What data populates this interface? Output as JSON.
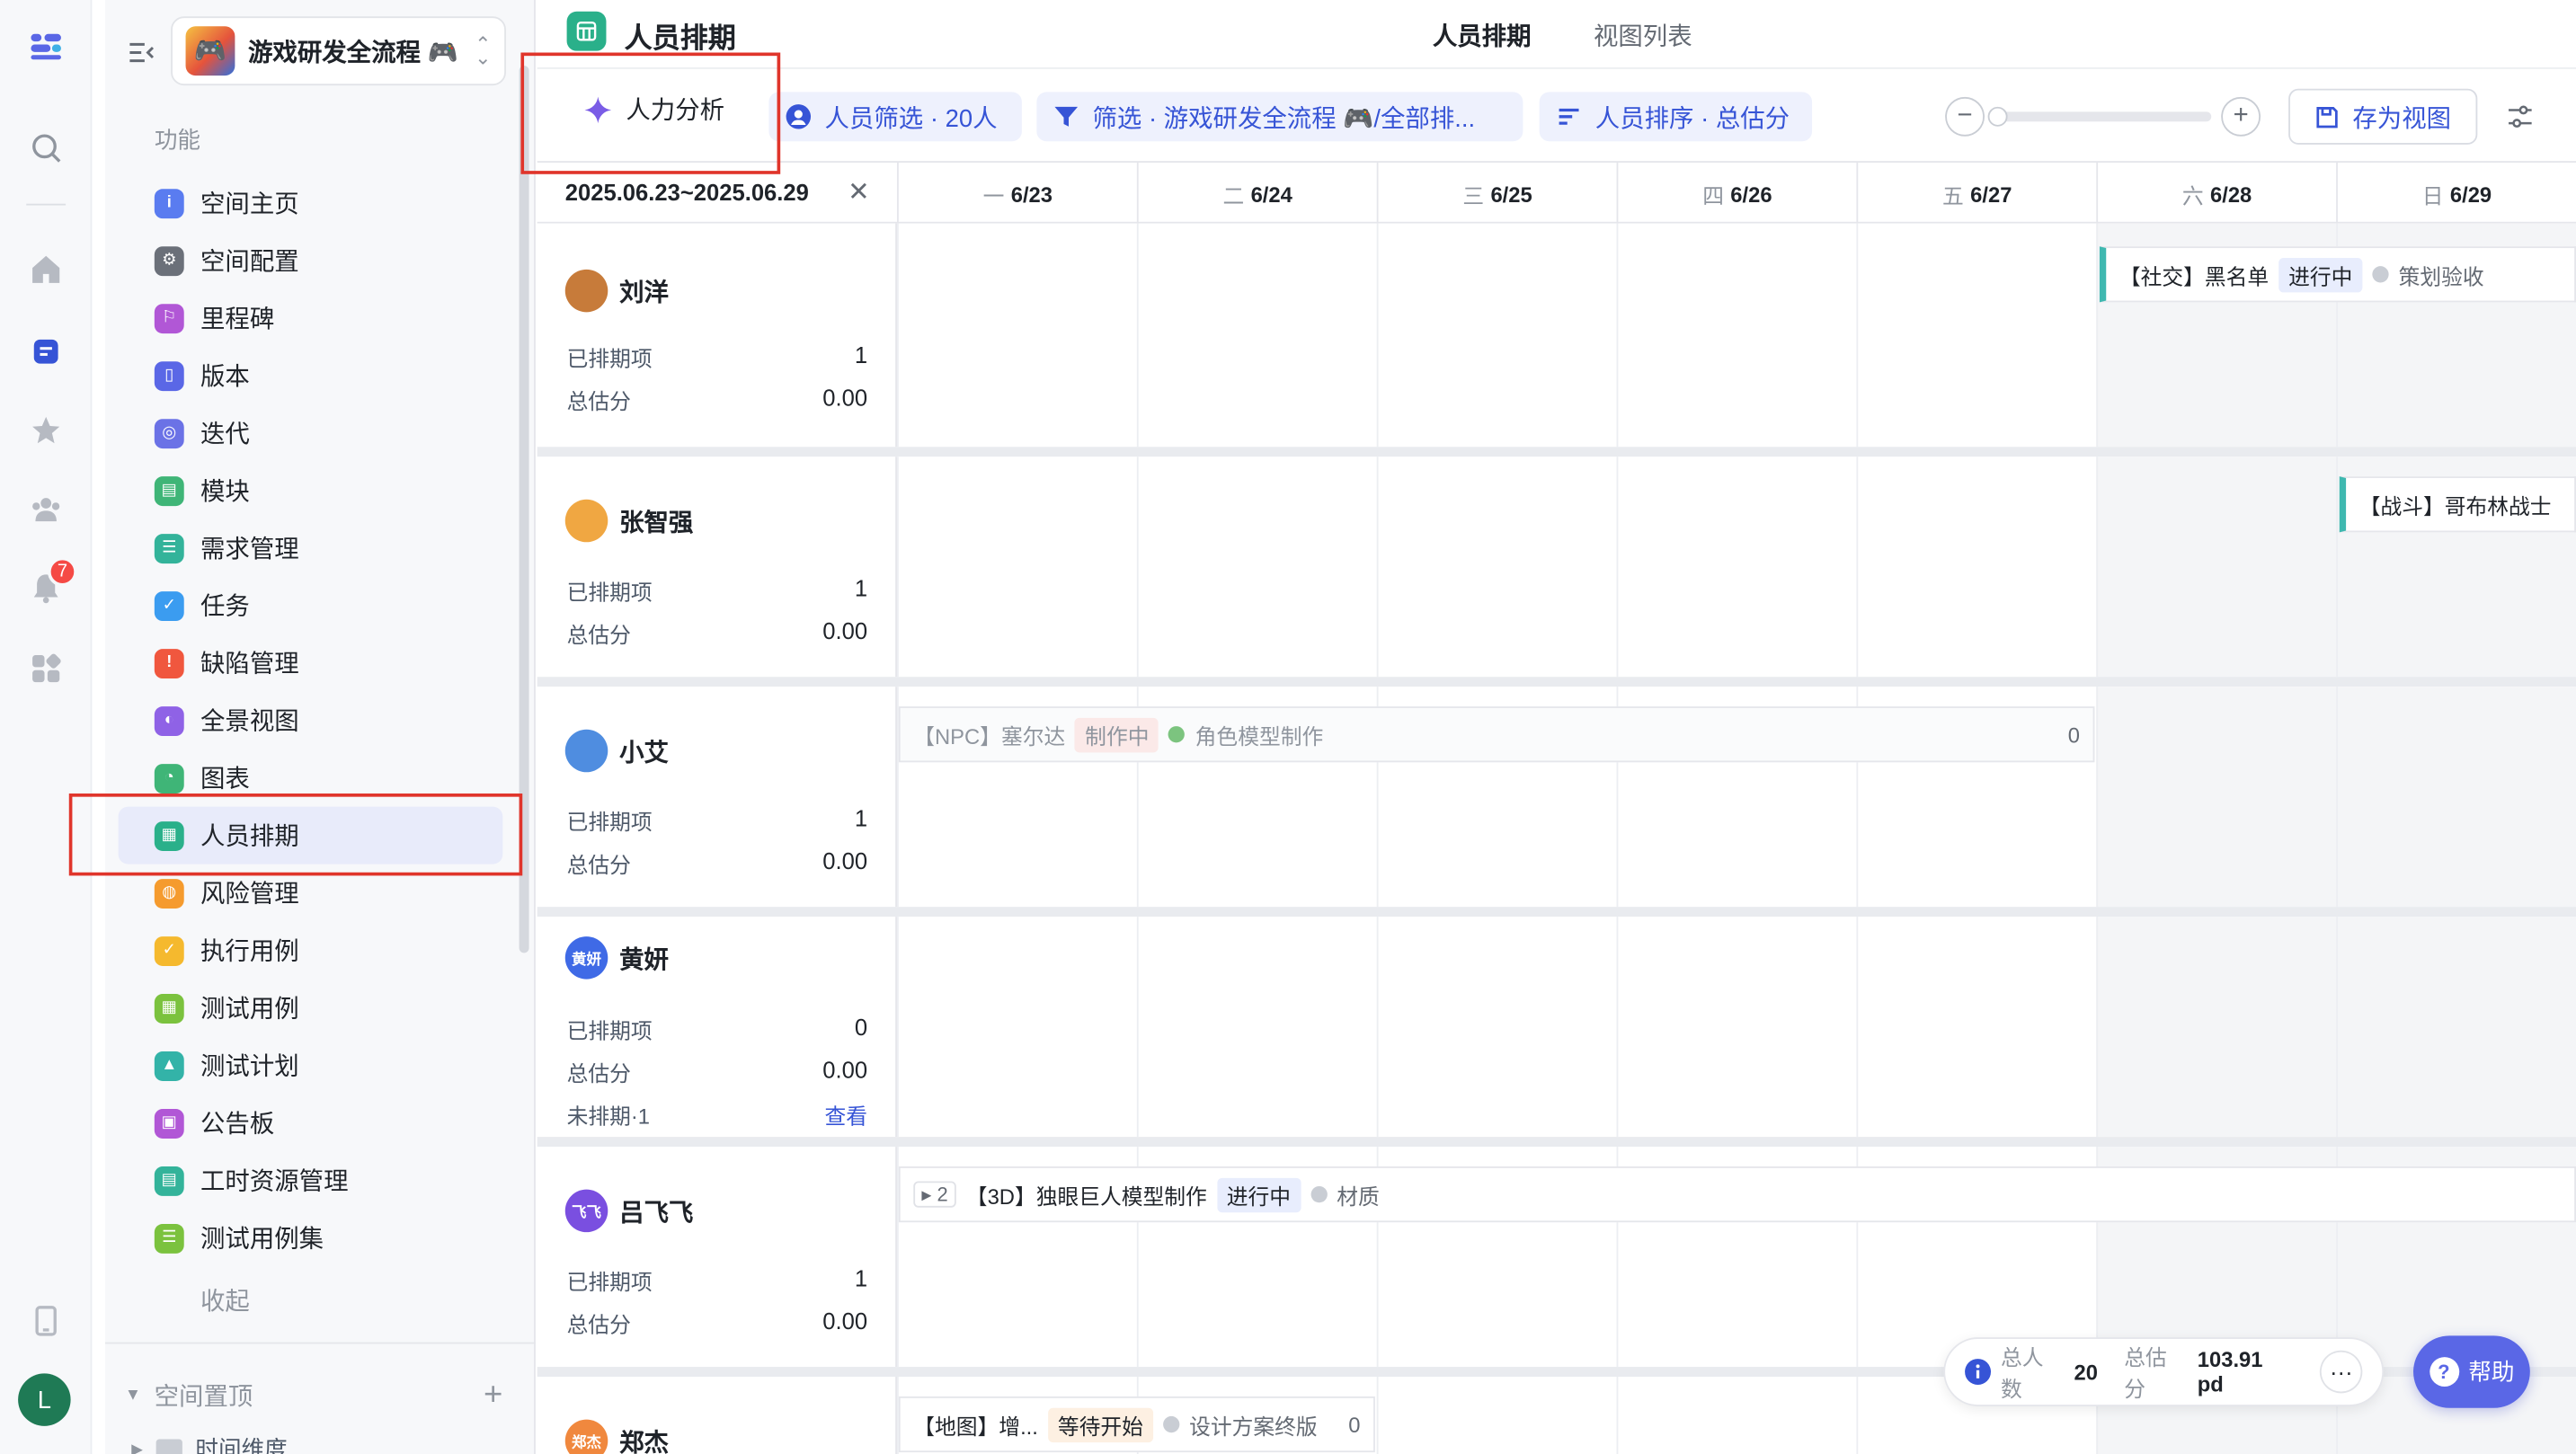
{
  "sidebar": {
    "space_name": "游戏研发全流程 🎮",
    "section_title": "功能",
    "items": [
      {
        "label": "空间主页",
        "color": "#5a7cf0",
        "glyph": "i"
      },
      {
        "label": "空间配置",
        "color": "#6b7079",
        "glyph": "⚙"
      },
      {
        "label": "里程碑",
        "color": "#b157d6",
        "glyph": "⚐"
      },
      {
        "label": "版本",
        "color": "#5a67e6",
        "glyph": "▯"
      },
      {
        "label": "迭代",
        "color": "#6b72e6",
        "glyph": "◎"
      },
      {
        "label": "模块",
        "color": "#3fb577",
        "glyph": "▤"
      },
      {
        "label": "需求管理",
        "color": "#33b39a",
        "glyph": "☰"
      },
      {
        "label": "任务",
        "color": "#3b9cf0",
        "glyph": "✓"
      },
      {
        "label": "缺陷管理",
        "color": "#f0573e",
        "glyph": "!"
      },
      {
        "label": "全景视图",
        "color": "#8f62e6",
        "glyph": "◐"
      },
      {
        "label": "图表",
        "color": "#3fb577",
        "glyph": "◔"
      },
      {
        "label": "人员排期",
        "color": "#2ab08a",
        "glyph": "▦"
      },
      {
        "label": "风险管理",
        "color": "#f59b2e",
        "glyph": "◍"
      },
      {
        "label": "执行用例",
        "color": "#f5b92e",
        "glyph": "✓"
      },
      {
        "label": "测试用例",
        "color": "#7bc23e",
        "glyph": "▦"
      },
      {
        "label": "测试计划",
        "color": "#33b3a8",
        "glyph": "▲"
      },
      {
        "label": "公告板",
        "color": "#b157d6",
        "glyph": "▣"
      },
      {
        "label": "工时资源管理",
        "color": "#33b39a",
        "glyph": "▤"
      },
      {
        "label": "测试用例集",
        "color": "#7bc23e",
        "glyph": "☰"
      }
    ],
    "fold_label": "收起",
    "pinned_title": "空间置顶",
    "pinned_add": "+",
    "pinned_sub": "时间维度"
  },
  "rail": {
    "notification_count": "7",
    "user_initial": "L"
  },
  "header": {
    "title": "人员排期",
    "tabs": [
      "人员排期",
      "视图列表"
    ]
  },
  "toolbar": {
    "ai_label": "人力分析",
    "people_filter": "人员筛选 · 20人",
    "filter": "筛选 · 游戏研发全流程 🎮/全部排...",
    "sort": "人员排序 · 总估分",
    "save_view": "存为视图"
  },
  "grid": {
    "range": "2025.06.23~2025.06.29",
    "days": [
      {
        "wk": "一",
        "date": "6/23"
      },
      {
        "wk": "二",
        "date": "6/24"
      },
      {
        "wk": "三",
        "date": "6/25"
      },
      {
        "wk": "四",
        "date": "6/26"
      },
      {
        "wk": "五",
        "date": "6/27"
      },
      {
        "wk": "六",
        "date": "6/28"
      },
      {
        "wk": "日",
        "date": "6/29"
      }
    ],
    "labels": {
      "scheduled": "已排期项",
      "estimate": "总估分",
      "unscheduled": "未排期·1",
      "view": "查看"
    }
  },
  "people": [
    {
      "name": "刘洋",
      "scheduled": "1",
      "estimate": "0.00",
      "avatar_color": "#c77b3a"
    },
    {
      "name": "张智强",
      "scheduled": "1",
      "estimate": "0.00",
      "avatar_color": "#f0a742"
    },
    {
      "name": "小艾",
      "scheduled": "1",
      "estimate": "0.00",
      "avatar_color": "#4f8de0"
    },
    {
      "name": "黄妍",
      "scheduled": "0",
      "estimate": "0.00",
      "avatar_color": "#3f6ae6",
      "avatar_text": "黄妍"
    },
    {
      "name": "吕飞飞",
      "scheduled": "1",
      "estimate": "0.00",
      "avatar_color": "#7a4fe0",
      "avatar_text": "飞飞"
    },
    {
      "name": "郑杰",
      "avatar_color": "#f0883e",
      "avatar_text": "郑杰"
    }
  ],
  "tasks": {
    "t1": {
      "title": "【社交】黑名单",
      "status": "进行中",
      "stage": "策划验收"
    },
    "t2": {
      "title": "【战斗】哥布林战士"
    },
    "t3": {
      "title": "【NPC】塞尔达",
      "status": "制作中",
      "stage": "角色模型制作",
      "count": "0"
    },
    "t4": {
      "sub": "▸ 2",
      "title": "【3D】独眼巨人模型制作",
      "status": "进行中",
      "stage": "材质"
    },
    "t5": {
      "title": "【地图】增...",
      "status": "等待开始",
      "stage": "设计方案终版",
      "count": "0"
    }
  },
  "summary": {
    "people_label": "总人数",
    "people_value": "20",
    "estimate_label": "总估分",
    "estimate_value": "103.91 pd",
    "more": "···"
  },
  "help": {
    "label": "帮助",
    "glyph": "?"
  }
}
